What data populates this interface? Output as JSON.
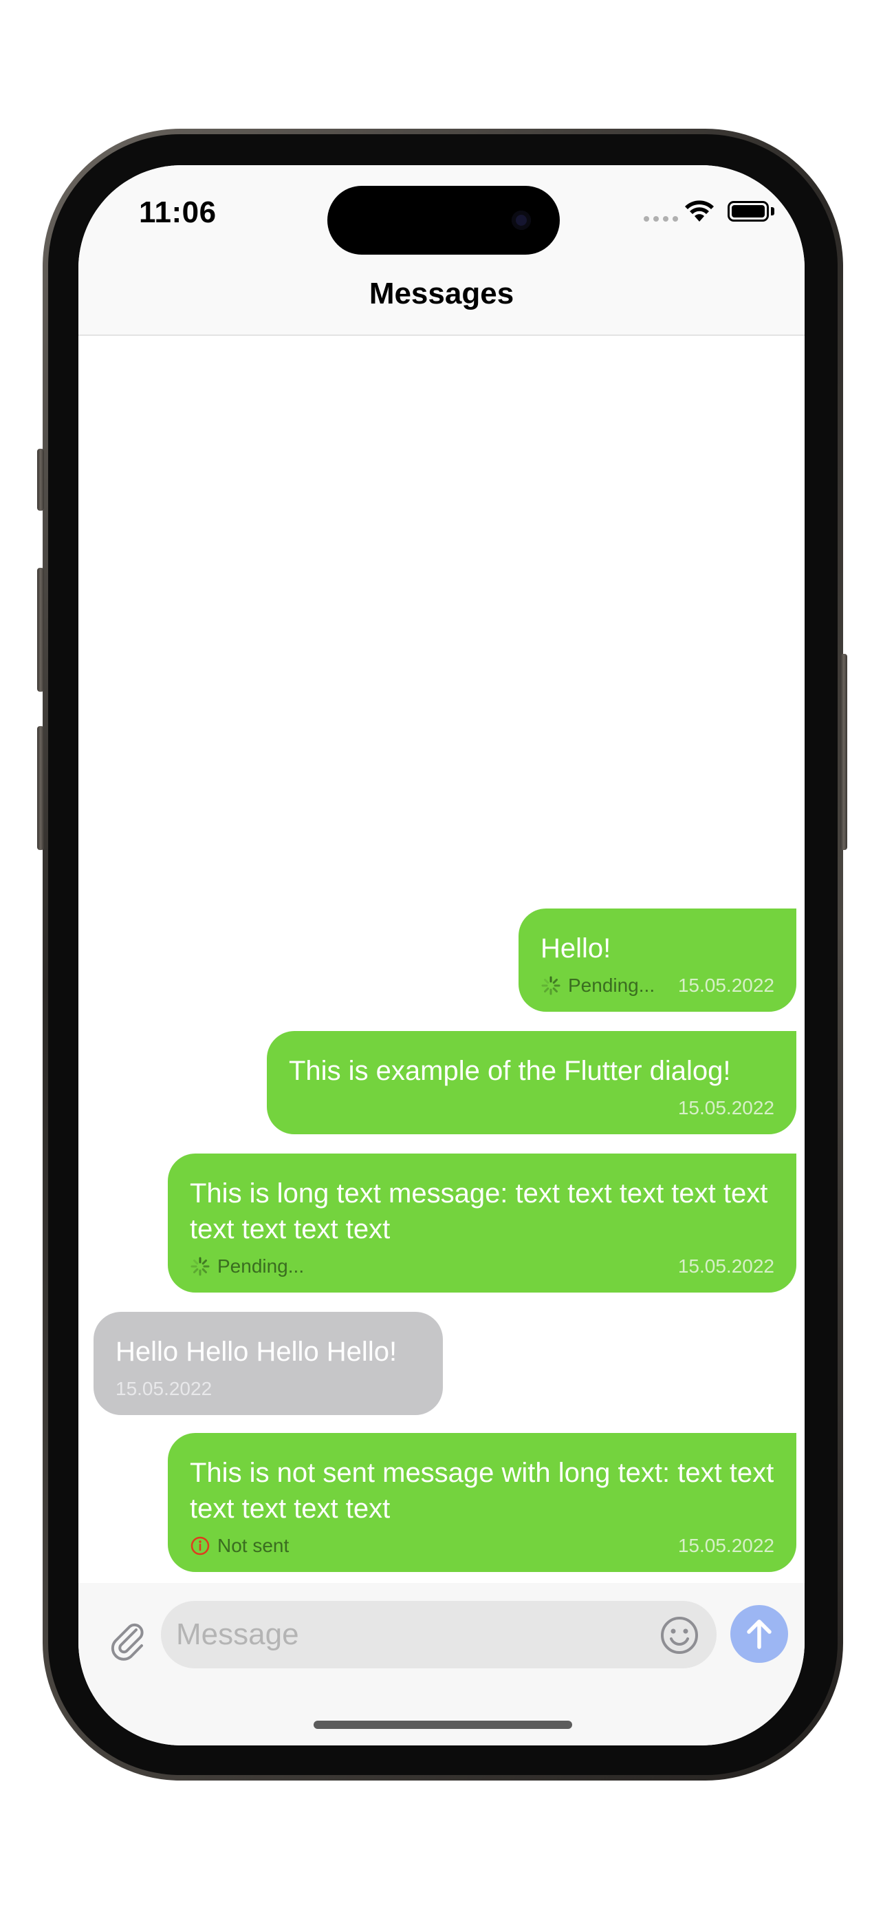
{
  "status_bar": {
    "time": "11:06"
  },
  "header": {
    "title": "Messages"
  },
  "messages": [
    {
      "direction": "outgoing",
      "text": "Hello!",
      "status": "Pending...",
      "date": "15.05.2022"
    },
    {
      "direction": "outgoing",
      "text": "This is example of the Flutter dialog!",
      "status": "",
      "date": "15.05.2022"
    },
    {
      "direction": "outgoing",
      "text": "This is long text message: text text text text text text text text text",
      "status": "Pending...",
      "date": "15.05.2022"
    },
    {
      "direction": "incoming",
      "text": "Hello Hello Hello Hello!",
      "status": "",
      "date": "15.05.2022"
    },
    {
      "direction": "outgoing",
      "text": "This is not sent message with long text: text text text text text text",
      "status": "Not sent",
      "date": "15.05.2022"
    }
  ],
  "input": {
    "placeholder": "Message",
    "value": ""
  },
  "icons": {
    "attach": "paperclip-icon",
    "emoji": "smiley-icon",
    "send": "arrow-up-icon",
    "pending": "spinner-icon",
    "error": "info-circle-icon"
  },
  "colors": {
    "outgoing_bubble": "#74d33e",
    "incoming_bubble": "#c6c6c8",
    "send_button": "#9cb6f3",
    "error": "#e03a1e"
  }
}
